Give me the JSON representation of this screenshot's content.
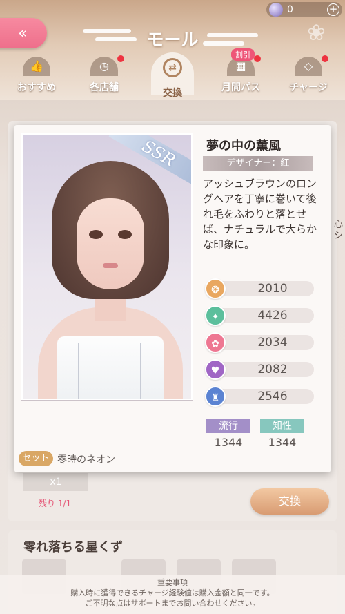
{
  "header": {
    "back_icon": "double-chevron-left-icon",
    "title": "モール",
    "currency": {
      "icon": "diamond-gem-icon",
      "value": "0",
      "add_icon": "plus-icon"
    }
  },
  "tabs": [
    {
      "label": "おすすめ",
      "icon": "thumbs-up-icon",
      "dot": false
    },
    {
      "label": "各店舗",
      "icon": "clock-icon",
      "dot": true
    },
    {
      "label": "交換",
      "icon": "exchange-icon",
      "active": true
    },
    {
      "label": "月間パス",
      "icon": "calendar-icon",
      "dot": true,
      "badge": "割引"
    },
    {
      "label": "チャージ",
      "icon": "diamond-icon",
      "dot": true
    }
  ],
  "modal": {
    "rarity": "SSR",
    "item_name": "夢の中の薫風",
    "designer": "デザイナー：紅",
    "description": "アッシュブラウンのロングヘアを丁寧に巻いて後れ毛をふわりと落とせば、ナチュラルで大らかな印象に。",
    "stats": [
      {
        "icon": "elegance-icon",
        "value": "2010",
        "color": "#e9a760"
      },
      {
        "icon": "freshness-icon",
        "value": "4426",
        "color": "#5cbf9c"
      },
      {
        "icon": "sweetness-icon",
        "value": "2034",
        "color": "#ee7792"
      },
      {
        "icon": "sexy-icon",
        "value": "2082",
        "color": "#a066c5"
      },
      {
        "icon": "cool-icon",
        "value": "2546",
        "color": "#5b83d2"
      }
    ],
    "tags": [
      {
        "label": "流行",
        "value": "1344",
        "color": "#a38fc8"
      },
      {
        "label": "知性",
        "value": "1344",
        "color": "#87c7be"
      }
    ],
    "set_label": "セット",
    "set_name": "零時のネオン"
  },
  "background": {
    "qty": "x1",
    "remaining": "残り 1/1",
    "exchange_label": "交換",
    "side_text": "心シ",
    "section_title": "零れ落ちる星くず",
    "notice_title": "重要事項",
    "notice_line1": "購入時に獲得できるチャージ経験値は購入金額と同一です。",
    "notice_line2": "ご不明な点はサポートまでお問い合わせください。"
  }
}
